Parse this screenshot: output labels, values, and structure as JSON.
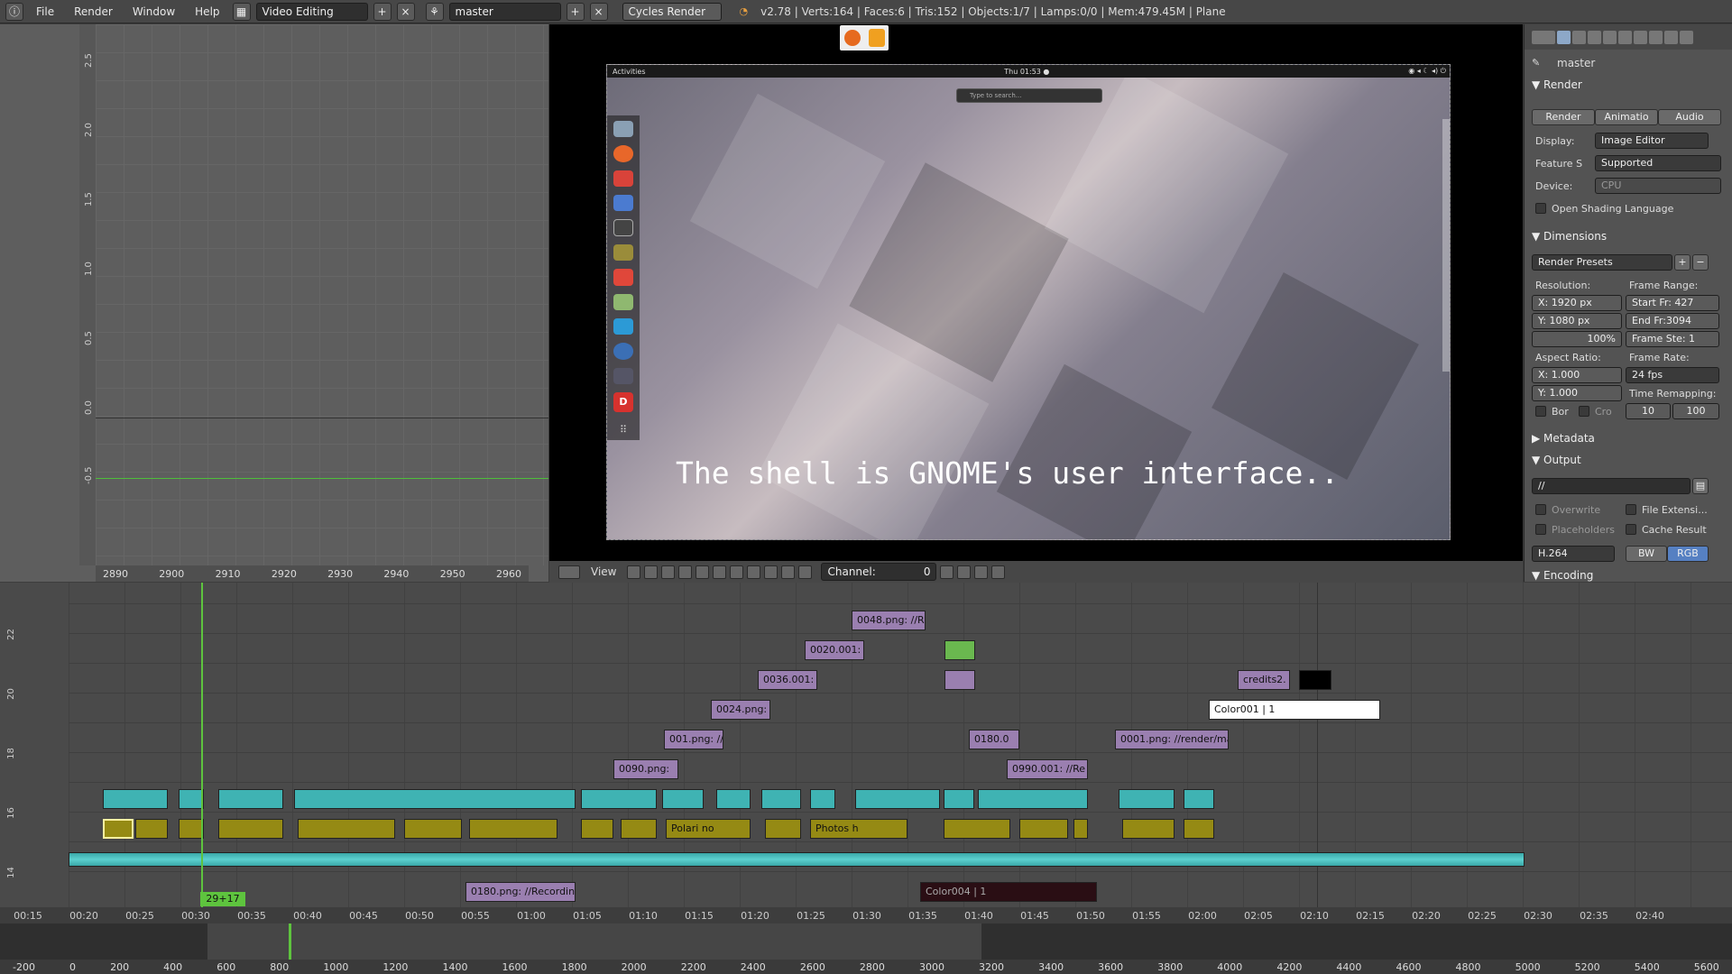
{
  "topbar": {
    "menus": [
      "File",
      "Render",
      "Window",
      "Help"
    ],
    "screen_layout": "Video Editing",
    "scene": "master",
    "engine": "Cycles Render",
    "stats": "v2.78 | Verts:164 | Faces:6 | Tris:152 | Objects:1/7 | Lamps:0/0 | Mem:479.45M | Plane"
  },
  "graph": {
    "y_ticks": [
      "2.5",
      "2.0",
      "1.5",
      "1.0",
      "0.5",
      "0.0",
      "-0.5"
    ],
    "x_ticks": [
      "2890",
      "2900",
      "2910",
      "2920",
      "2930",
      "2940",
      "2950",
      "2960"
    ]
  },
  "preview": {
    "gnome_top_left": "Activities",
    "gnome_clock": "Thu 01:53 ●",
    "search_placeholder": "Type to search...",
    "subtitle": "The shell is GNOME's user interface..",
    "header": {
      "view": "View",
      "channel_label": "Channel:",
      "channel_value": "0"
    }
  },
  "props": {
    "scene": "master",
    "render_title": "Render",
    "render_buttons": [
      "Render",
      "Animatio",
      "Audio"
    ],
    "display_label": "Display:",
    "display_value": "Image Editor",
    "feature_label": "Feature S",
    "feature_value": "Supported",
    "device_label": "Device:",
    "device_value": "CPU",
    "osl": "Open Shading Language",
    "dimensions_title": "Dimensions",
    "render_presets": "Render Presets",
    "resolution_label": "Resolution:",
    "res_x": "X:   1920 px",
    "res_y": "Y:   1080 px",
    "res_pct": "100%",
    "frame_range_label": "Frame Range:",
    "start": "Start Fr: 427",
    "end": "End Fr:3094",
    "step": "Frame Ste: 1",
    "aspect_label": "Aspect Ratio:",
    "asp_x": "X:      1.000",
    "asp_y": "Y:      1.000",
    "frame_rate_label": "Frame Rate:",
    "fps": "24 fps",
    "time_remap_label": "Time Remapping:",
    "remap_old": "10",
    "remap_new": "100",
    "border": "Bor",
    "crop": "Cro",
    "metadata_title": "Metadata",
    "output_title": "Output",
    "output_path": "//",
    "overwrite": "Overwrite",
    "file_ext": "File Extensi...",
    "placeholders": "Placeholders",
    "cache_result": "Cache Result",
    "format": "H.264",
    "bw": "BW",
    "rgb": "RGB",
    "encoding_title": "Encoding"
  },
  "sequencer": {
    "lane_labels": [
      "22",
      "20",
      "18",
      "16",
      "14"
    ],
    "strips": {
      "s0048": "0048.png: //R",
      "s0020": "0020.001:",
      "s0036": "0036.001:",
      "credits": "credits2.",
      "s0024": "0024.png:",
      "color001": "Color001 | 1",
      "s001": "001.png: //",
      "s0180a": "0180.0",
      "s0001": "0001.png: //render/ma",
      "s0090": "0090.png:",
      "s0990": "0990.001: //Re",
      "polari": "Polari no",
      "photos": "Photos h",
      "s0180b": "0180.png: //Recording",
      "color004": "Color004 | 1"
    },
    "current_frame": "29+17",
    "time_ticks": [
      "00:15",
      "00:20",
      "00:25",
      "00:30",
      "00:35",
      "00:40",
      "00:45",
      "00:50",
      "00:55",
      "01:00",
      "01:05",
      "01:10",
      "01:15",
      "01:20",
      "01:25",
      "01:30",
      "01:35",
      "01:40",
      "01:45",
      "01:50",
      "01:55",
      "02:00",
      "02:05",
      "02:10",
      "02:15",
      "02:20",
      "02:25",
      "02:30",
      "02:35",
      "02:40"
    ]
  },
  "timeline": {
    "ticks": [
      "-200",
      "0",
      "200",
      "400",
      "600",
      "800",
      "1000",
      "1200",
      "1400",
      "1600",
      "1800",
      "2000",
      "2200",
      "2400",
      "2600",
      "2800",
      "3000",
      "3200",
      "3400",
      "3600",
      "3800",
      "4000",
      "4200",
      "4400",
      "4600",
      "4800",
      "5000",
      "5200",
      "5400",
      "5600"
    ]
  }
}
